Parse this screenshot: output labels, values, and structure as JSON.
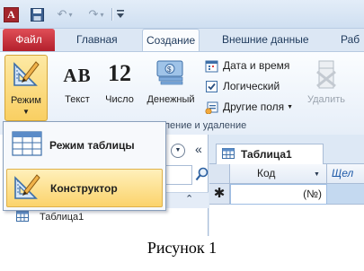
{
  "title_bar": {
    "app_icon_letter": "A",
    "icons": [
      "save-icon",
      "undo-icon",
      "redo-icon",
      "customize-icon"
    ]
  },
  "tabs": [
    {
      "label": "Файл"
    },
    {
      "label": "Главная"
    },
    {
      "label": "Создание"
    },
    {
      "label": "Внешние данные"
    },
    {
      "label": "Раб"
    }
  ],
  "ribbon": {
    "mode_button": "Режим",
    "add_group": {
      "text": {
        "glyph": "AB",
        "label": "Текст"
      },
      "number": {
        "glyph": "12",
        "label": "Число"
      },
      "money": {
        "label": "Денежный"
      }
    },
    "small_buttons": [
      {
        "label": "Дата и время",
        "icon": "calendar-icon"
      },
      {
        "label": "Логический",
        "icon": "checkbox-icon"
      },
      {
        "label": "Другие поля",
        "icon": "more-fields-icon"
      }
    ],
    "delete_button": "Удалить",
    "group_label": "вление и удаление"
  },
  "mode_menu": {
    "items": [
      {
        "label": "Режим таблицы",
        "icon": "datasheet-view-icon"
      },
      {
        "label": "Конструктор",
        "icon": "design-view-icon"
      }
    ]
  },
  "nav_pane": {
    "item": "Таблица1"
  },
  "datasheet": {
    "tab": "Таблица1",
    "columns": [
      "Код",
      "Щел"
    ],
    "new_row_marker": "✱",
    "new_row_value": "(№)"
  },
  "caption": "Рисунок 1"
}
